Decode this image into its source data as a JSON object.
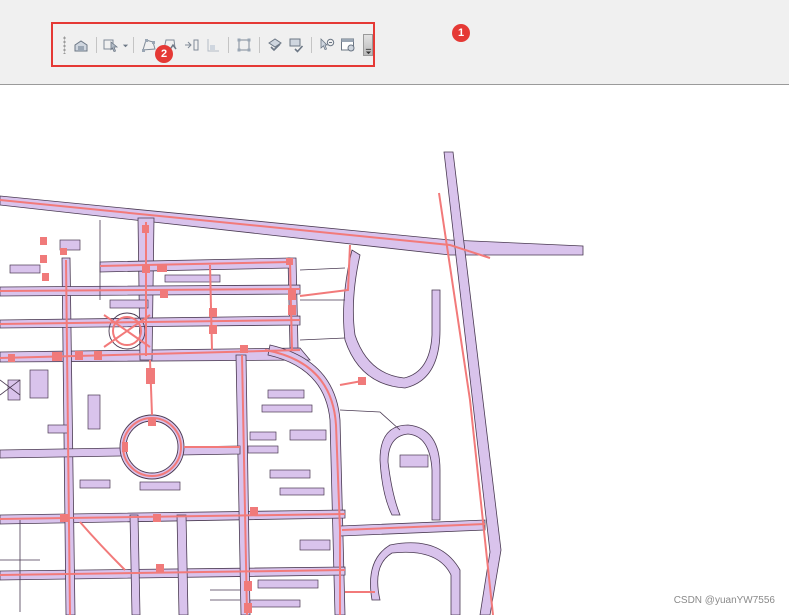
{
  "annotations": {
    "badge1": "1",
    "badge2": "2"
  },
  "toolbar": {
    "buttons": [
      {
        "name": "toolbar-grip",
        "icon": "grip-icon"
      },
      {
        "name": "editor-toolbar-button",
        "icon": "toolbox-icon"
      },
      {
        "name": "edit-tool-button",
        "icon": "edit-arrow-icon"
      },
      {
        "name": "edit-tool-dropdown",
        "icon": "chevron-down-icon"
      },
      {
        "name": "edit-vertices-button",
        "icon": "vertices-icon"
      },
      {
        "name": "reshape-feature-button",
        "icon": "reshape-icon"
      },
      {
        "name": "split-tool-button",
        "icon": "split-icon"
      },
      {
        "name": "rotate-tool-button",
        "icon": "rotate-icon"
      },
      {
        "name": "topology-edit-button",
        "icon": "topology-icon"
      },
      {
        "name": "validate-topology-button",
        "icon": "validate-icon"
      },
      {
        "name": "fix-topology-error-button",
        "icon": "fix-error-icon"
      },
      {
        "name": "error-inspector-button",
        "icon": "error-inspector-icon"
      },
      {
        "name": "topology-properties-button",
        "icon": "properties-icon"
      },
      {
        "name": "toolbar-overflow-button",
        "icon": "overflow-icon"
      }
    ]
  },
  "map": {
    "colors": {
      "road_fill": "#d9c3ec",
      "road_edge": "#4a3a52",
      "network_line": "#f27a7a",
      "network_node": "#f07a7a",
      "background": "#ffffff"
    }
  },
  "footer": {
    "watermark": "CSDN @yuanYW7556"
  }
}
